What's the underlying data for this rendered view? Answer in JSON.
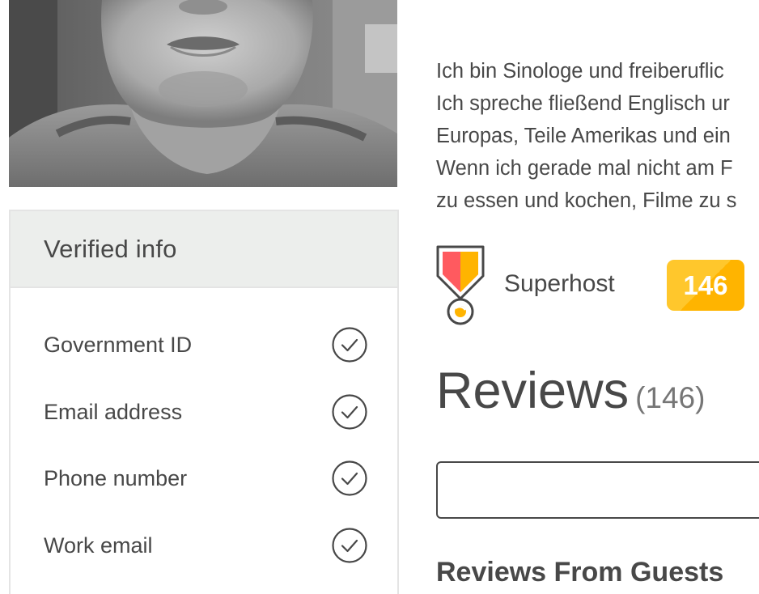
{
  "profile": {
    "photo_alt": "host-photo"
  },
  "verified_info": {
    "title": "Verified info",
    "items": [
      {
        "label": "Government ID",
        "icon": "check-circle-icon"
      },
      {
        "label": "Email address",
        "icon": "check-circle-icon"
      },
      {
        "label": "Phone number",
        "icon": "check-circle-icon"
      },
      {
        "label": "Work email",
        "icon": "check-circle-icon"
      }
    ]
  },
  "about": {
    "lines": [
      "Ich bin Sinologe und freiberuflic",
      "Ich spreche fließend Englisch ur",
      "Europas, Teile Amerikas und ein",
      "Wenn ich gerade mal nicht am F",
      "zu essen und kochen, Filme zu s"
    ]
  },
  "superhost": {
    "label": "Superhost",
    "icon": "superhost-medal-icon",
    "badge_count": "146",
    "badge_color": "#FFB400"
  },
  "reviews": {
    "title": "Reviews",
    "count": "(146)",
    "search_value": "",
    "from_guests_title": "Reviews From Guests"
  },
  "colors": {
    "text": "#484848",
    "muted": "#767676",
    "border": "#E4E4E4",
    "header_bg": "#ECEEEC",
    "accent_pink": "#FF5A5F",
    "accent_yellow": "#FFB400"
  }
}
